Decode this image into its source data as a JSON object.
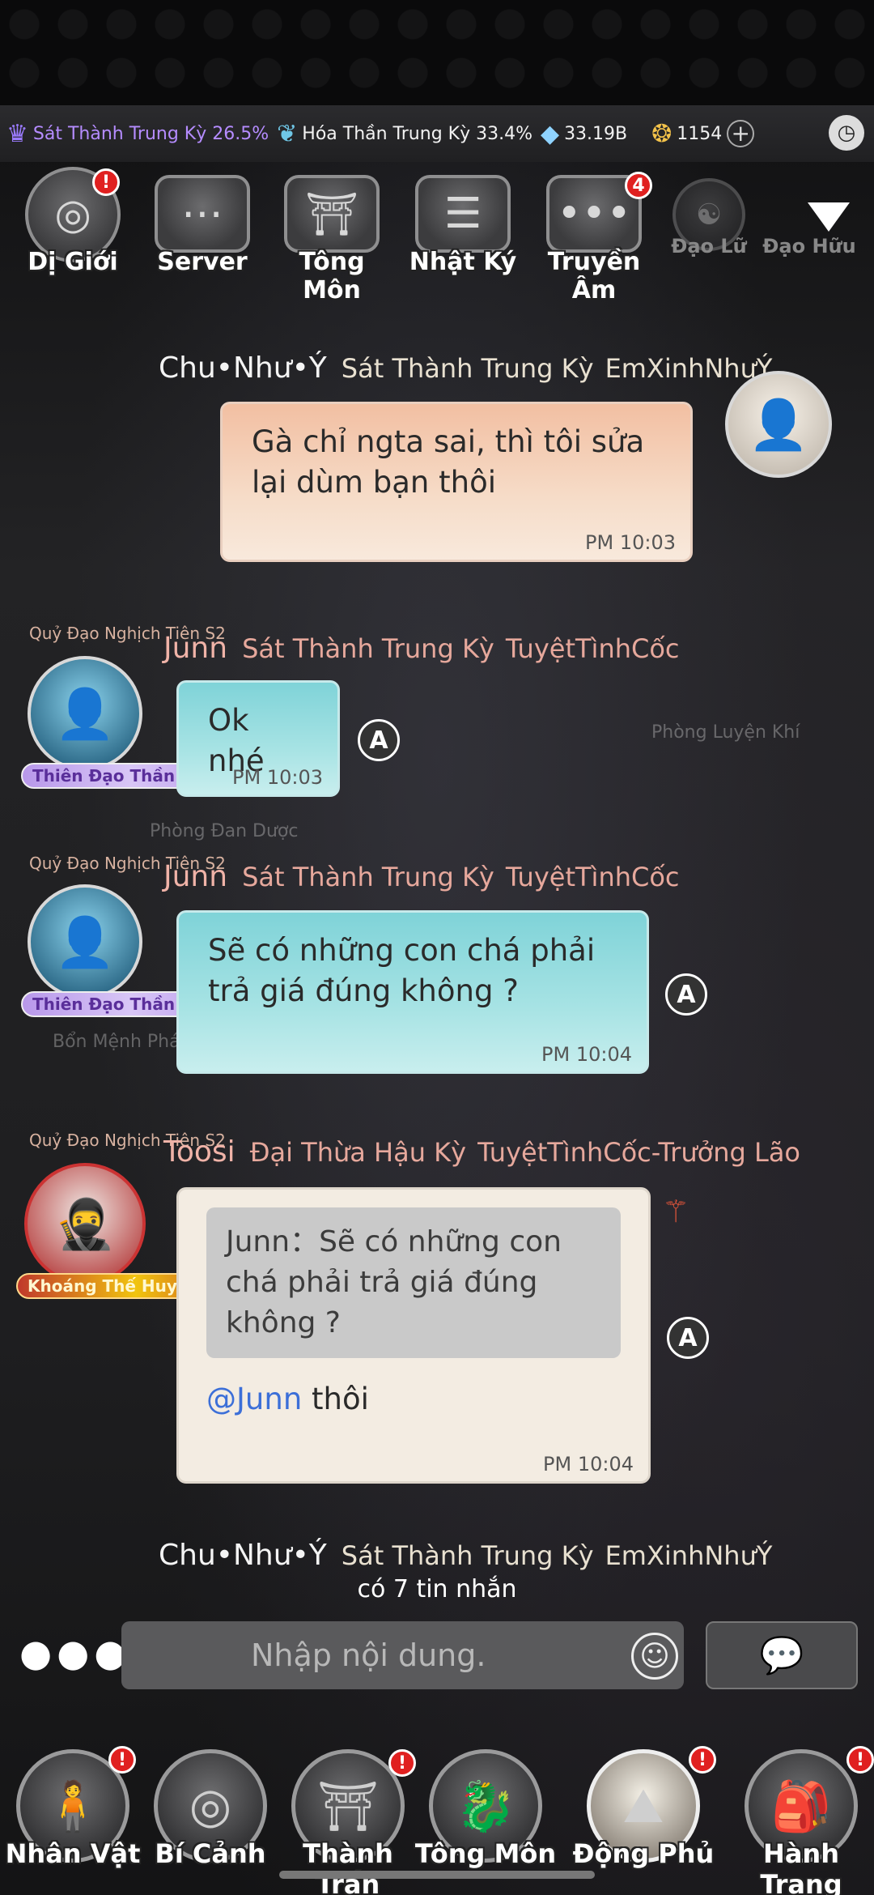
{
  "status": {
    "cultivation_1": "Sát Thành Trung Kỳ 26.5%",
    "cultivation_2": "Hóa Thần Trung Kỳ 33.4%",
    "spirit_stones": "33.19B",
    "gold": "1154"
  },
  "tabs": [
    {
      "label": "Dị Giới",
      "badge": "!"
    },
    {
      "label": "Server",
      "badge": ""
    },
    {
      "label": "Tông Môn",
      "badge": ""
    },
    {
      "label": "Nhật Ký",
      "badge": ""
    },
    {
      "label": "Truyền Âm",
      "badge": "4"
    },
    {
      "label": "Đạo Lữ",
      "badge": ""
    },
    {
      "label": "Đạo Hữu",
      "badge": ""
    }
  ],
  "ghost_labels": {
    "luyen_khi": "Phòng Luyện Khí",
    "dan_duoc": "Phòng Đan Dược",
    "ban_menh": "Bổn Mệnh Pháp"
  },
  "messages": [
    {
      "name": "Chu•Như•Ý",
      "realm": "Sát Thành Trung Kỳ",
      "sect": "EmXinhNhưÝ",
      "text": "Gà chỉ ngta sai, thì tôi sửa lại dùm bạn thôi",
      "time": "PM 10:03"
    },
    {
      "name": "Junn",
      "realm": "Sát Thành Trung Kỳ",
      "sect": "TuyệtTìnhCốc",
      "title": "Quỷ Đạo Nghịch Tiên S2",
      "frame": "Thiên Đạo Thần Quân",
      "text": "Ok nhé",
      "time": "PM 10:03"
    },
    {
      "name": "Junn",
      "realm": "Sát Thành Trung Kỳ",
      "sect": "TuyệtTìnhCốc",
      "title": "Quỷ Đạo Nghịch Tiên S2",
      "frame": "Thiên Đạo Thần Quân",
      "text": "Sẽ có những con chá phải trả giá đúng không ?",
      "time": "PM 10:04"
    },
    {
      "name": "Toosi",
      "realm": "Đại Thừa Hậu Kỳ",
      "sect": "TuyệtTìnhCốc-Trưởng Lão",
      "title": "Quỷ Đạo Nghịch Tiên S2",
      "frame": "Khoáng Thế Huyền Tiên",
      "quote": "Junn：Sẽ có những con chá phải trả giá đúng không ?",
      "mention": "@Junn",
      "text": " thôi",
      "time": "PM 10:04"
    },
    {
      "name": "Chu•Như•Ý",
      "realm": "Sát Thành Trung Kỳ",
      "sect": "EmXinhNhưÝ"
    }
  ],
  "new_messages": "có 7 tin nhắn",
  "input": {
    "placeholder": "Nhập nội dung."
  },
  "bottom_nav": [
    {
      "label": "Nhân Vật"
    },
    {
      "label": "Bí Cảnh"
    },
    {
      "label": "Thành Trấn"
    },
    {
      "label": "Tông Môn"
    },
    {
      "label": "Động Phủ"
    },
    {
      "label": "Hành Trang"
    }
  ]
}
